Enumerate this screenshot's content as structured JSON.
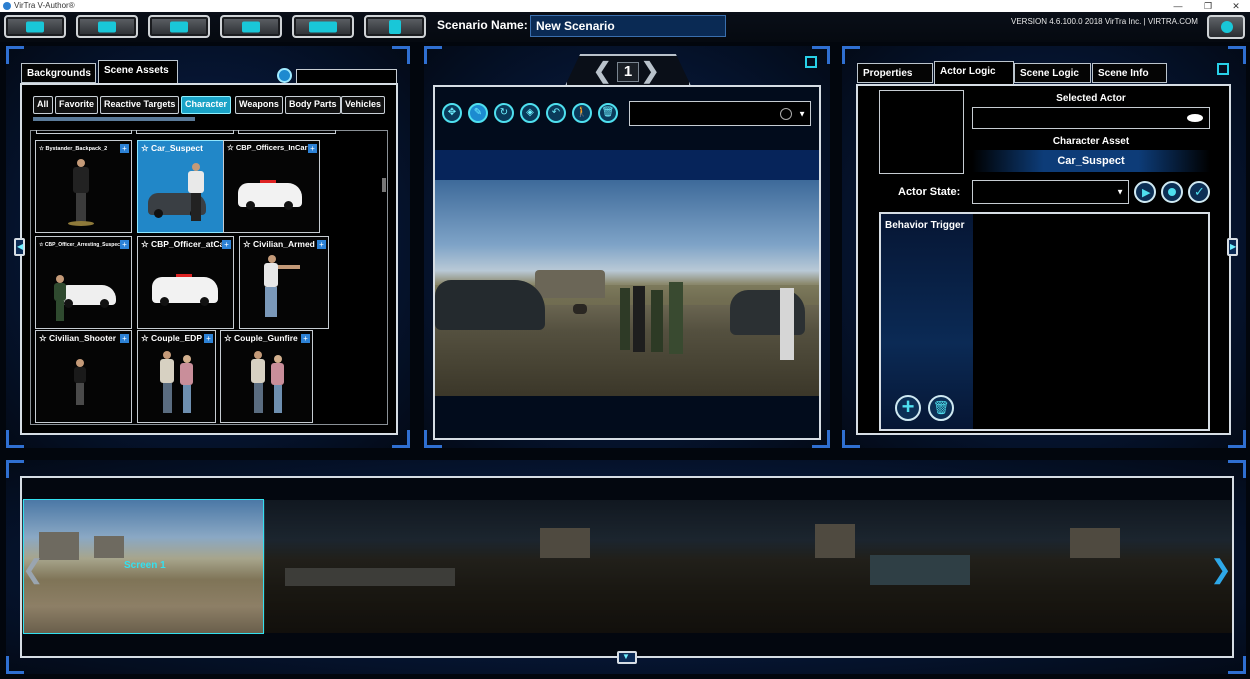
{
  "window": {
    "title": "VirTra V-Author®",
    "buttons": [
      "—",
      "❐",
      "✕"
    ]
  },
  "toolbar": {
    "buttons": [
      "new-scenario-icon",
      "open-scenario-icon",
      "save-icon",
      "media-icon",
      "playback-icon",
      "export-icon"
    ],
    "scenario_label": "Scenario Name:",
    "scenario_value": "New Scenario",
    "version": "VERSION 4.6.100.0   2018 VirTra Inc. | VIRTRA.COM"
  },
  "assets_panel": {
    "tabs": [
      "Backgrounds",
      "Scene Assets"
    ],
    "active_tab": "Scene Assets",
    "search_value": "",
    "filters": [
      "All",
      "Favorite",
      "Reactive Targets",
      "Character",
      "Weapons",
      "Body Parts",
      "Vehicles"
    ],
    "active_filter": "Character",
    "items": [
      {
        "name": "Bystander_Backpack_2"
      },
      {
        "name": "Car_Suspect"
      },
      {
        "name": "CBP_Officers_InCar"
      },
      {
        "name": "CBP_Officer_Arresting_Suspect"
      },
      {
        "name": "CBP_Officer_atCar"
      },
      {
        "name": "Civilian_Armed"
      },
      {
        "name": "Civilian_Shooter"
      },
      {
        "name": "Couple_EDP"
      },
      {
        "name": "Couple_Gunfire"
      }
    ],
    "selected_item": "Car_Suspect"
  },
  "viewport": {
    "screen_number": "1",
    "tools": [
      "move-icon",
      "edit-icon",
      "rotate-icon",
      "flip-icon",
      "undo-icon",
      "walk-icon",
      "delete-icon"
    ],
    "actor_select_value": ""
  },
  "logic_panel": {
    "tabs": [
      "Properties",
      "Actor Logic",
      "Scene Logic",
      "Scene Info"
    ],
    "active_tab": "Actor Logic",
    "selected_actor_label": "Selected Actor",
    "selected_actor_value": "",
    "character_asset_label": "Character Asset",
    "character_asset_value": "Car_Suspect",
    "actor_state_label": "Actor State:",
    "actor_state_value": "",
    "behavior_trigger_label": "Behavior Trigger"
  },
  "filmstrip": {
    "screens": [
      {
        "label": "Screen 1"
      }
    ]
  },
  "colors": {
    "accent": "#19c7d8",
    "panel_blue": "#0b2a55",
    "selected_blue": "#2187c8",
    "frame_border": "#d6dde4"
  }
}
